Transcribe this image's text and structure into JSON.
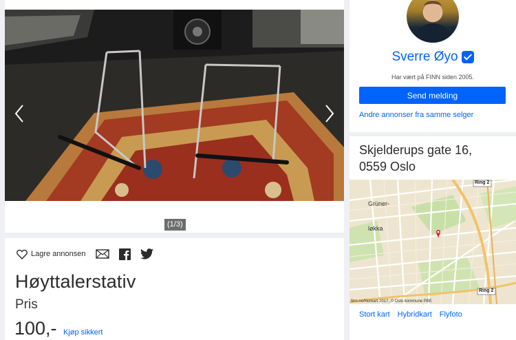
{
  "gallery": {
    "counter": "(1/3)",
    "prev_icon": "chevron-left-icon",
    "next_icon": "chevron-right-icon"
  },
  "ad": {
    "save_label": "Lagre annonsen",
    "title": "Høyttalerstativ",
    "price_label": "Pris",
    "price": "100,-",
    "buy_safely": "Kjøp sikkert"
  },
  "seller": {
    "name": "Sverre Øyo",
    "member_since": "Har vært på FINN siden 2005.",
    "send_message": "Send melding",
    "other_ads": "Andre annonser fra samme selger"
  },
  "location": {
    "address_line1": "Skjelderups gate 16,",
    "address_line2": "0559 Oslo",
    "map_credit": "finn.no/Norkart 2017, © Oslo kommune PBE",
    "map_labels": {
      "grunerlokka_top": "Grüner-",
      "grunerlokka_bottom": "løkka",
      "ring2_top": "Ring 2",
      "ring2_bottom": "Ring 2"
    },
    "links": [
      "Stort kart",
      "Hybridkart",
      "Flyfoto"
    ]
  },
  "colors": {
    "accent": "#0063fb",
    "background": "#eff0f4",
    "card": "#ffffff"
  }
}
